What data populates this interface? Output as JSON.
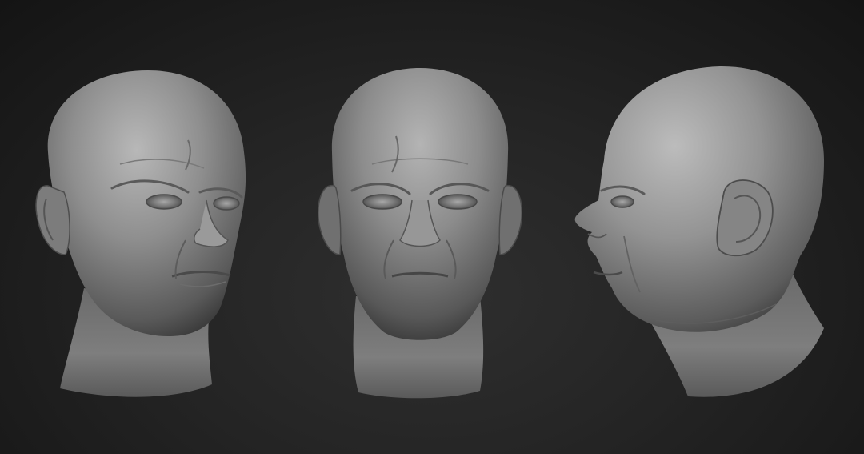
{
  "scene": {
    "type": "3d-sculpt-render",
    "subject": "bald male head",
    "views": [
      {
        "id": "three-quarter",
        "name": "head-view-three-quarter"
      },
      {
        "id": "front",
        "name": "head-view-front"
      },
      {
        "id": "profile",
        "name": "head-view-profile"
      }
    ],
    "colors": {
      "background_center": "#2f2f2f",
      "background_edge": "#141414",
      "clay_light": "#b4b4b4",
      "clay_mid": "#8a8a8a",
      "clay_dark": "#4a4a4a"
    }
  }
}
